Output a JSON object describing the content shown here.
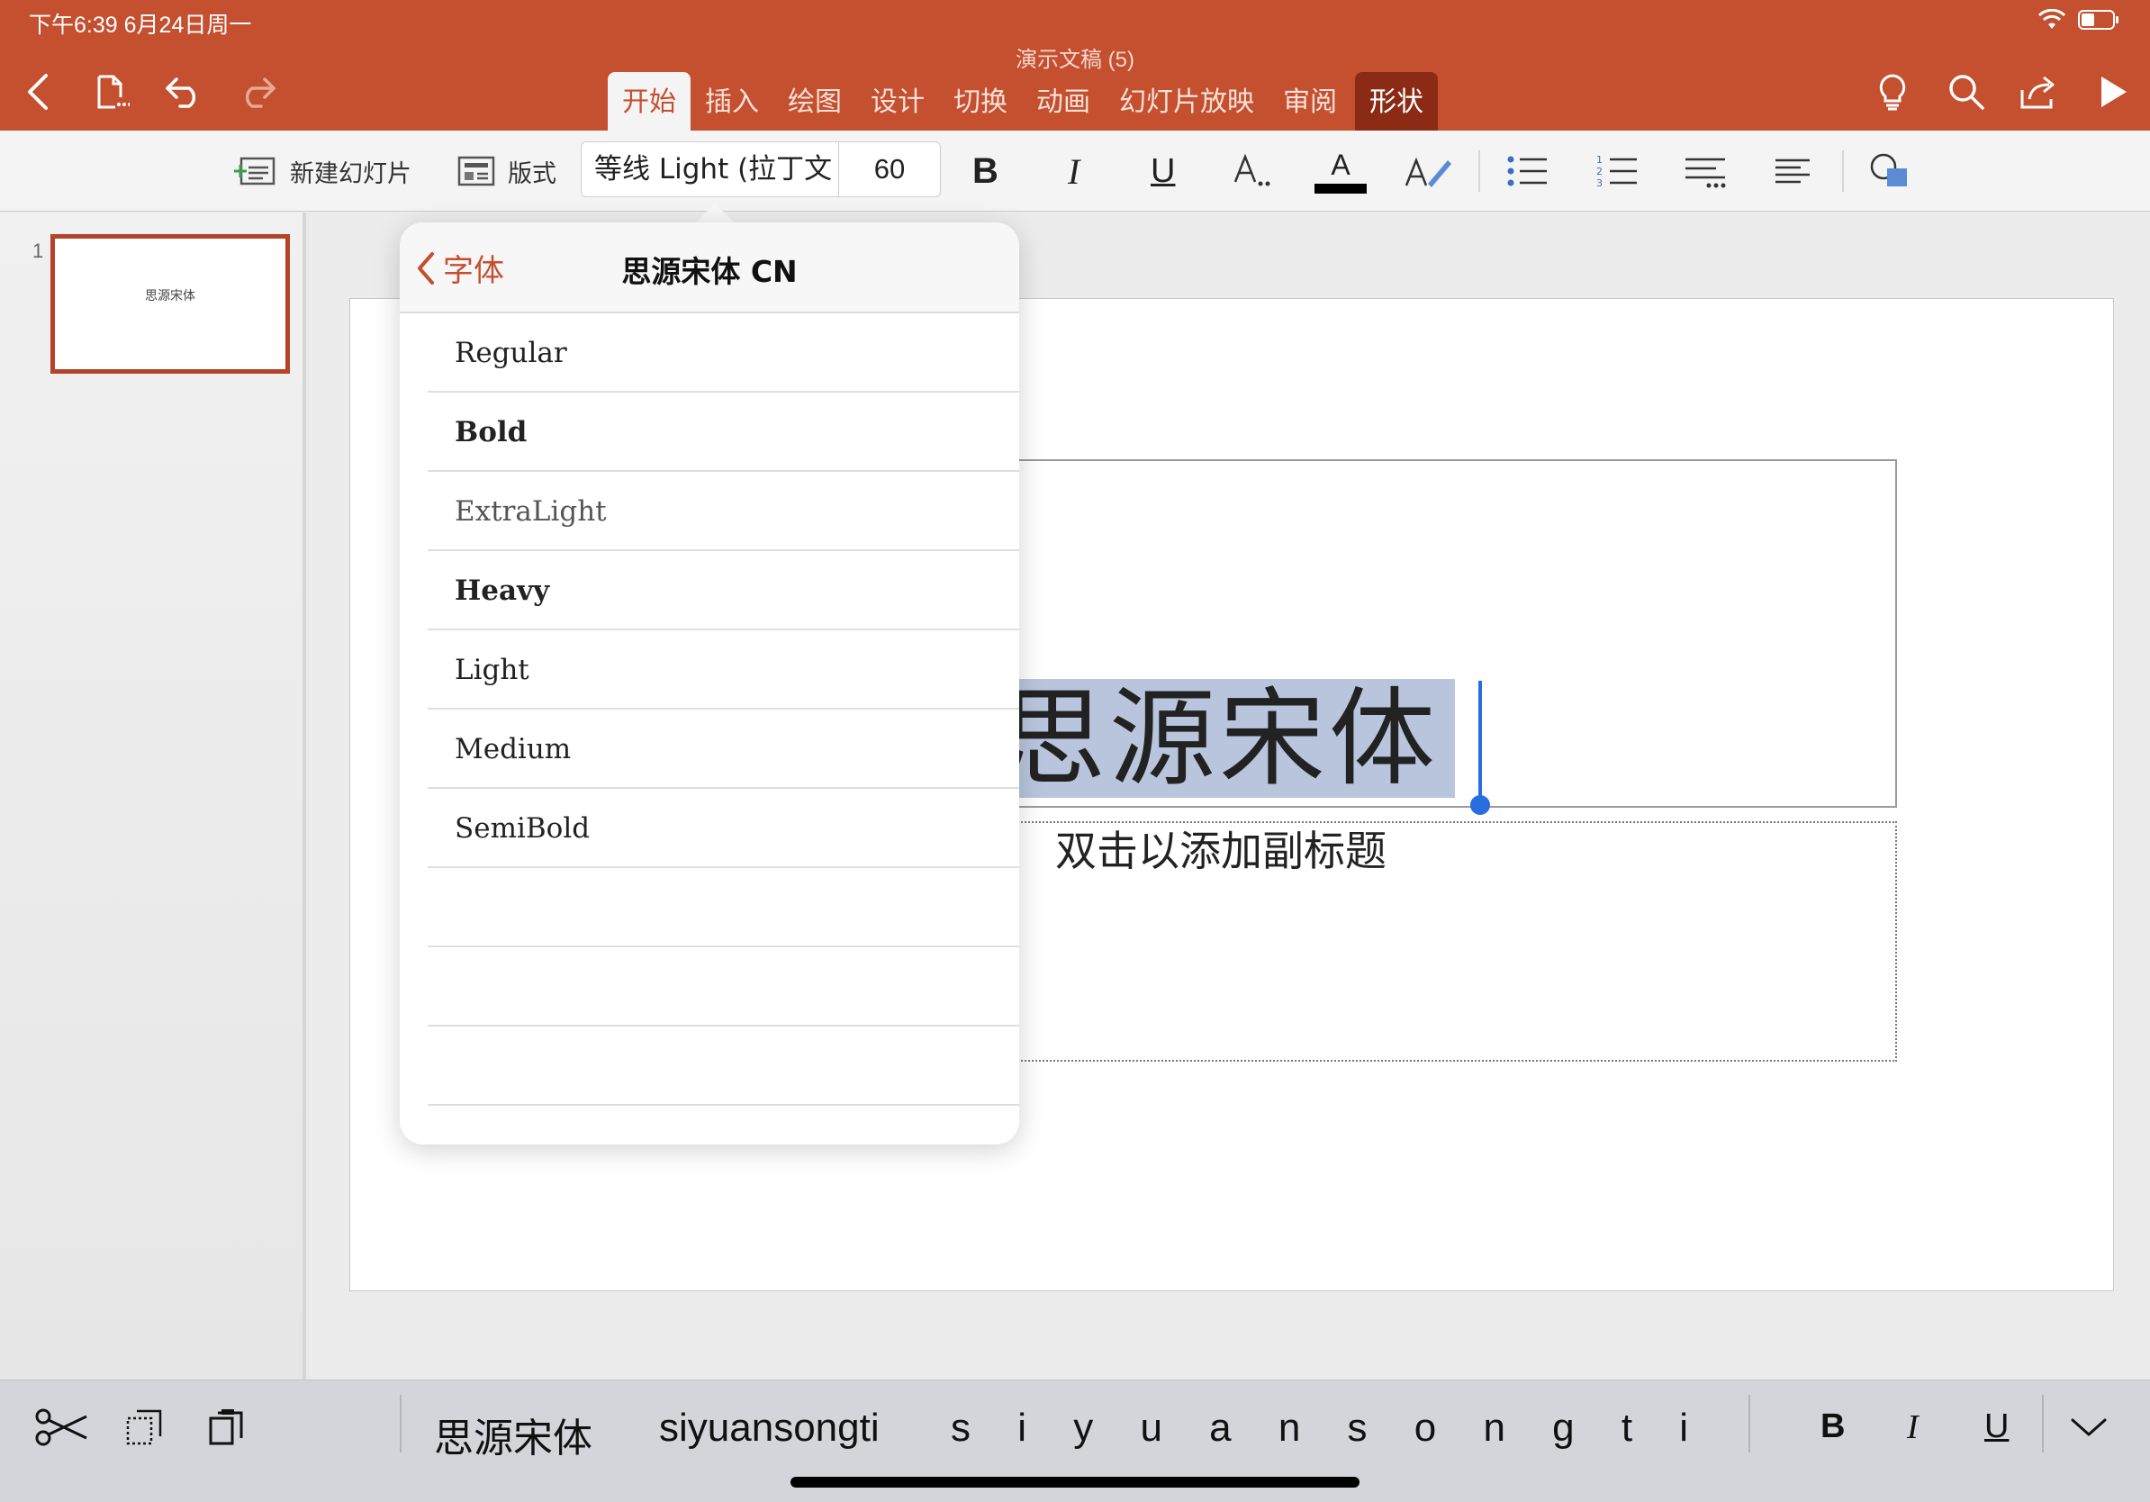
{
  "status": {
    "time": "下午6:39   6月24日周一"
  },
  "document": {
    "title": "演示文稿 (5)"
  },
  "tabs": [
    {
      "label": "开始"
    },
    {
      "label": "插入"
    },
    {
      "label": "绘图"
    },
    {
      "label": "设计"
    },
    {
      "label": "切换"
    },
    {
      "label": "动画"
    },
    {
      "label": "幻灯片放映"
    },
    {
      "label": "审阅"
    },
    {
      "label": "形状"
    }
  ],
  "ribbon": {
    "new_slide": "新建幻灯片",
    "layout": "版式",
    "font_name": "等线 Light (拉丁文",
    "font_size": "60",
    "bold": "B",
    "italic": "I",
    "underline": "U",
    "font_color_letter": "A",
    "font_color": "#000000"
  },
  "thumbnail": {
    "number": "1",
    "text": "思源宋体"
  },
  "slide": {
    "title": "思源宋体",
    "subtitle_placeholder": "双击以添加副标题"
  },
  "font_popover": {
    "back_label": "字体",
    "title": "思源宋体 CN",
    "weights": [
      "Regular",
      "Bold",
      "ExtraLight",
      "Heavy",
      "Light",
      "Medium",
      "SemiBold"
    ]
  },
  "shortcut_bar": {
    "candidates": [
      "思源宋体",
      "siyuansongti",
      "s i y u a n s o n g t i"
    ],
    "bold": "B",
    "italic": "I",
    "underline": "U"
  },
  "colors": {
    "accent": "#c4502f",
    "selection": "#b8c5dc",
    "caret": "#2a6de0"
  }
}
